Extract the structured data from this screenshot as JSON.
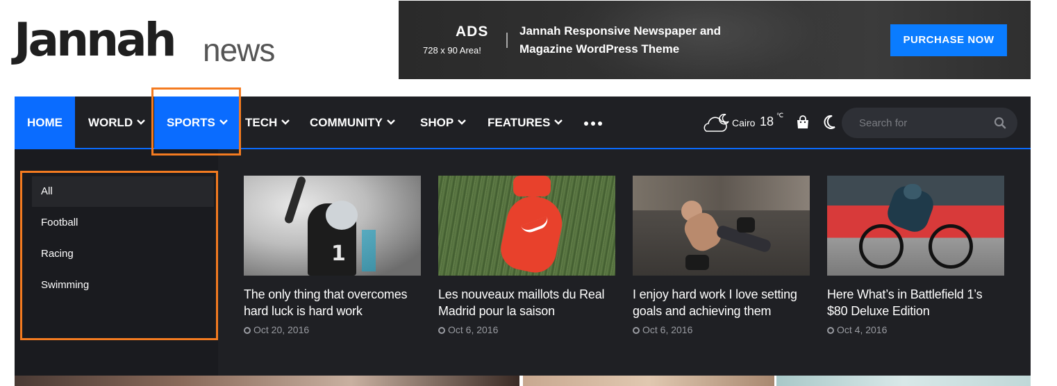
{
  "logo": {
    "main": "Jannah",
    "sub": "news"
  },
  "ad": {
    "title": "ADS",
    "subtitle": "728 x 90 Area!",
    "text": "Jannah Responsive Newspaper and Magazine WordPress Theme",
    "button": "PURCHASE NOW",
    "accent": "#0a7cff"
  },
  "nav": {
    "items": [
      {
        "label": "HOME",
        "dropdown": false
      },
      {
        "label": "WORLD",
        "dropdown": true
      },
      {
        "label": "SPORTS",
        "dropdown": true
      },
      {
        "label": "TECH",
        "dropdown": true
      },
      {
        "label": "COMMUNITY",
        "dropdown": true
      },
      {
        "label": "SHOP",
        "dropdown": true
      },
      {
        "label": "FEATURES",
        "dropdown": true
      }
    ],
    "more_icon": "more-dots-icon",
    "accent": "#0a6cff"
  },
  "weather": {
    "city": "Cairo",
    "temp": "18",
    "unit": "℃",
    "icon": "cloud-moon-icon"
  },
  "search": {
    "placeholder": "Search for"
  },
  "submenu": [
    "All",
    "Football",
    "Racing",
    "Swimming"
  ],
  "posts": [
    {
      "title": "The only thing that overcomes hard luck is hard work",
      "date": "Oct 20, 2016"
    },
    {
      "title": "Les nouveaux maillots du Real Madrid pour la saison",
      "date": "Oct 6, 2016"
    },
    {
      "title": "I enjoy hard work I love setting goals and achieving them",
      "date": "Oct 6, 2016"
    },
    {
      "title": "Here What’s in Battlefield 1’s $80 Deluxe Edition",
      "date": "Oct 4, 2016"
    }
  ],
  "highlight_color": "#f47b20"
}
